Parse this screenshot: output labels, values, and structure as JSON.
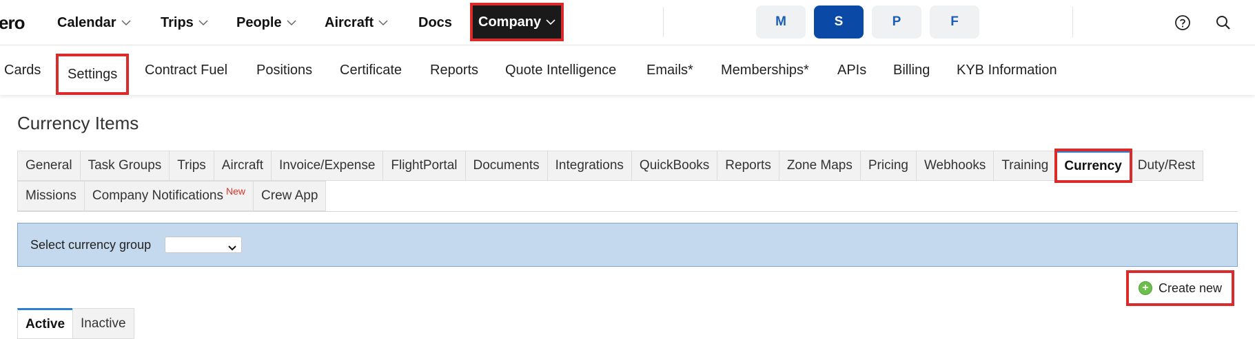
{
  "topnav": {
    "logo": "ero",
    "items": [
      {
        "label": "Calendar",
        "dropdown": true
      },
      {
        "label": "Trips",
        "dropdown": true
      },
      {
        "label": "People",
        "dropdown": true
      },
      {
        "label": "Aircraft",
        "dropdown": true
      },
      {
        "label": "Docs",
        "dropdown": false
      },
      {
        "label": "Company",
        "dropdown": true
      }
    ],
    "pills": [
      {
        "label": "M",
        "active": false
      },
      {
        "label": "S",
        "active": true
      },
      {
        "label": "P",
        "active": false
      },
      {
        "label": "F",
        "active": false
      }
    ],
    "icons": [
      "help-icon",
      "search-icon"
    ]
  },
  "subnav": {
    "items": [
      "Cards",
      "Settings",
      "Contract Fuel",
      "Positions",
      "Certificate",
      "Reports",
      "Quote Intelligence",
      "Emails*",
      "Memberships*",
      "APIs",
      "Billing",
      "KYB Information"
    ]
  },
  "page": {
    "title": "Currency Items"
  },
  "tabs": {
    "row1": [
      "General",
      "Task Groups",
      "Trips",
      "Aircraft",
      "Invoice/Expense",
      "FlightPortal",
      "Documents",
      "Integrations",
      "QuickBooks",
      "Reports",
      "Zone Maps",
      "Pricing",
      "Webhooks",
      "Training",
      "Currency",
      "Duty/Rest"
    ],
    "row2": [
      "Missions",
      "Company Notifications",
      "Crew App"
    ],
    "new_badge": "New",
    "active": "Currency"
  },
  "currency_group": {
    "label": "Select currency group",
    "selected": ""
  },
  "actions": {
    "create_new": "Create new"
  },
  "status_tabs": {
    "active": "Active",
    "inactive": "Inactive"
  },
  "colors": {
    "highlight": "#d92b2b",
    "accent_blue": "#0a4aa6",
    "tab_active_border": "#2d7fd1",
    "panel_bg": "#c5d9ee"
  }
}
